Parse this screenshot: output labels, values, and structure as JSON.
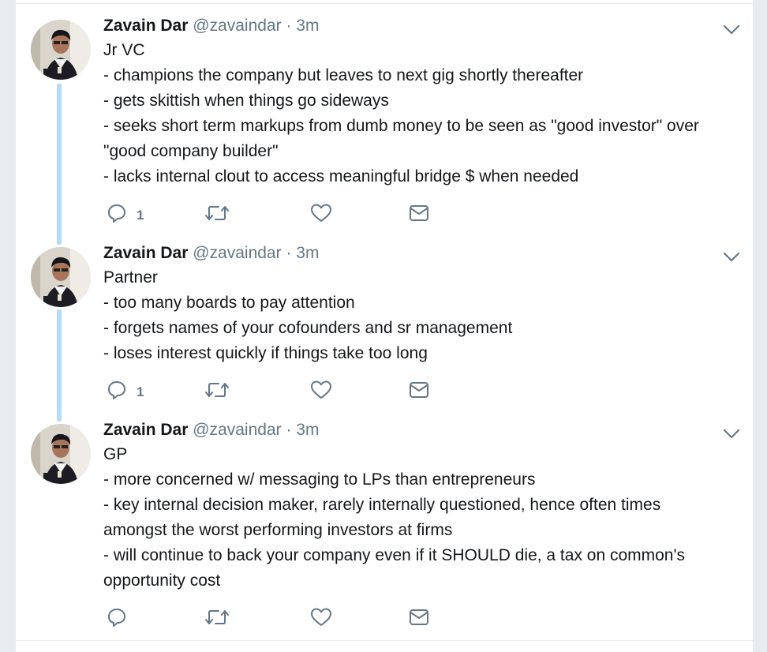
{
  "tweets": [
    {
      "name": "Zavain Dar",
      "handle": "@zavaindar",
      "separator": "·",
      "time": "3m",
      "lines": [
        "Jr VC",
        "- champions the company but leaves to next gig shortly thereafter",
        "- gets skittish when things go sideways",
        "- seeks short term markups from dumb money to be seen as \"good investor\" over",
        "\"good company builder\"",
        "- lacks internal clout to access meaningful bridge $ when needed"
      ],
      "reply_count": "1"
    },
    {
      "name": "Zavain Dar",
      "handle": "@zavaindar",
      "separator": "·",
      "time": "3m",
      "lines": [
        "Partner",
        "- too many boards to pay attention",
        "- forgets names of your cofounders and sr management",
        "- loses interest quickly if things take too long"
      ],
      "reply_count": "1"
    },
    {
      "name": "Zavain Dar",
      "handle": "@zavaindar",
      "separator": "·",
      "time": "3m",
      "lines": [
        "GP",
        "- more concerned w/ messaging to LPs than entrepreneurs",
        "- key internal decision maker, rarely internally questioned, hence often times",
        "amongst the worst performing investors at firms",
        "- will continue to back your company even if it SHOULD die, a tax on common's",
        "opportunity cost"
      ],
      "reply_count": ""
    }
  ],
  "icons": {
    "reply": "reply-icon",
    "retweet": "retweet-icon",
    "like": "heart-icon",
    "dm": "envelope-icon",
    "caret": "chevron-down-icon"
  },
  "colors": {
    "thread_line": "#b5dcf6",
    "icon": "#657786",
    "text": "#14171a",
    "muted": "#657786"
  }
}
